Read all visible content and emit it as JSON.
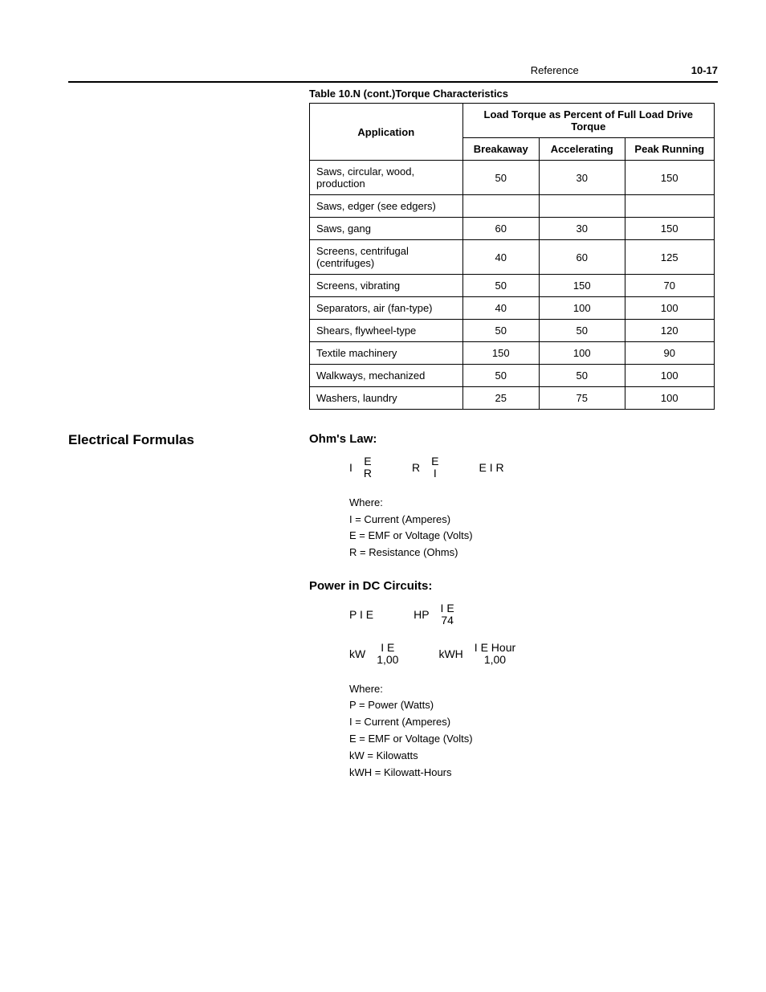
{
  "header": {
    "chapter": "Reference",
    "page_number": "10-17"
  },
  "table": {
    "caption": "Table 10.N  (cont.)Torque Characteristics",
    "col_group_title": "Load Torque as Percent of Full Load Drive Torque",
    "col_app": "Application",
    "col_break": "Breakaway",
    "col_accel": "Accelerating",
    "col_peak": "Peak Running",
    "rows": [
      {
        "app": "Saws, circular, wood, production",
        "b": "50",
        "a": "30",
        "p": "150"
      },
      {
        "app": "Saws, edger (see edgers)",
        "b": "",
        "a": "",
        "p": ""
      },
      {
        "app": "Saws, gang",
        "b": "60",
        "a": "30",
        "p": "150"
      },
      {
        "app": "Screens, centrifugal (centrifuges)",
        "b": "40",
        "a": "60",
        "p": "125"
      },
      {
        "app": "Screens, vibrating",
        "b": "50",
        "a": "150",
        "p": "70"
      },
      {
        "app": "Separators, air (fan-type)",
        "b": "40",
        "a": "100",
        "p": "100"
      },
      {
        "app": "Shears, flywheel-type",
        "b": "50",
        "a": "50",
        "p": "120"
      },
      {
        "app": "Textile machinery",
        "b": "150",
        "a": "100",
        "p": "90"
      },
      {
        "app": "Walkways, mechanized",
        "b": "50",
        "a": "50",
        "p": "100"
      },
      {
        "app": "Washers, laundry",
        "b": "25",
        "a": "75",
        "p": "100"
      }
    ]
  },
  "sections": {
    "left_heading": "Electrical Formulas",
    "ohms": {
      "title": "Ohm's Law:",
      "f1_lhs": "I",
      "f1_top": "E",
      "f1_bot": "R",
      "f2_lhs": "R",
      "f2_top": "E",
      "f2_bot": "I",
      "f3": "E    I   R",
      "where_label": "Where:",
      "w1": "I = Current (Amperes)",
      "w2": "E = EMF or Voltage (Volts)",
      "w3": "R = Resistance (Ohms)"
    },
    "dc": {
      "title": "Power in DC Circuits:",
      "f1": "P    I   E",
      "f2_lhs": "HP",
      "f2_top": "I   E",
      "f2_bot": "74",
      "f3_lhs": "kW",
      "f3_top": "I   E",
      "f3_bot": "1,00",
      "f4_lhs": "kWH",
      "f4_top": "I   E   Hour",
      "f4_bot": "1,00",
      "where_label": "Where:",
      "w1": "P = Power (Watts)",
      "w2": "I = Current (Amperes)",
      "w3": "E = EMF or Voltage (Volts)",
      "w4": "kW = Kilowatts",
      "w5": "kWH = Kilowatt-Hours"
    }
  }
}
